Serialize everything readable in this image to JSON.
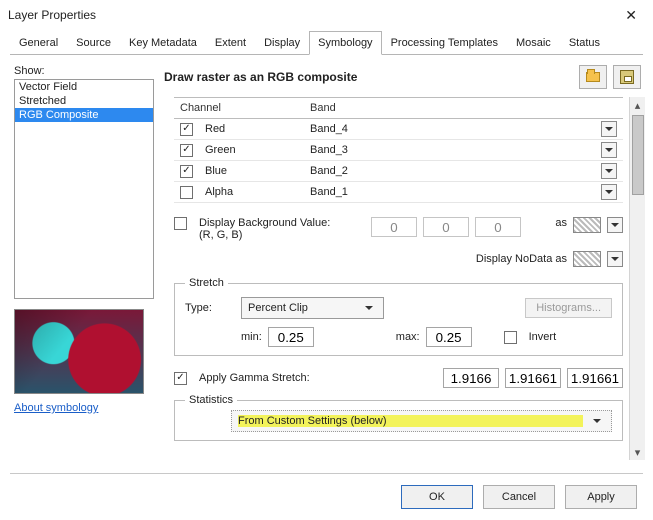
{
  "window": {
    "title": "Layer Properties"
  },
  "tabs": [
    "General",
    "Source",
    "Key Metadata",
    "Extent",
    "Display",
    "Symbology",
    "Processing Templates",
    "Mosaic",
    "Status"
  ],
  "active_tab": "Symbology",
  "left": {
    "show_label": "Show:",
    "items": [
      "Vector Field",
      "Stretched",
      "RGB Composite"
    ],
    "selected": "RGB Composite",
    "about_link": "About symbology"
  },
  "header": {
    "title": "Draw raster as an RGB composite"
  },
  "channels": {
    "col_channel": "Channel",
    "col_band": "Band",
    "rows": [
      {
        "checked": true,
        "name": "Red",
        "band": "Band_4"
      },
      {
        "checked": true,
        "name": "Green",
        "band": "Band_3"
      },
      {
        "checked": true,
        "name": "Blue",
        "band": "Band_2"
      },
      {
        "checked": false,
        "name": "Alpha",
        "band": "Band_1"
      }
    ]
  },
  "bg": {
    "checked": false,
    "label": "Display Background Value:(R, G, B)",
    "r": "0",
    "g": "0",
    "b": "0",
    "as_label": "as"
  },
  "nodata": {
    "label": "Display NoData as"
  },
  "stretch": {
    "legend": "Stretch",
    "type_label": "Type:",
    "type_value": "Percent Clip",
    "histograms": "Histograms...",
    "min_label": "min:",
    "min": "0.25",
    "max_label": "max:",
    "max": "0.25",
    "invert_label": "Invert",
    "invert_checked": false
  },
  "gamma": {
    "checked": true,
    "label": "Apply Gamma Stretch:",
    "v1": "1.9166",
    "v2": "1.91661",
    "v3": "1.91661"
  },
  "stats": {
    "legend": "Statistics",
    "source": "From Custom Settings (below)"
  },
  "footer": {
    "ok": "OK",
    "cancel": "Cancel",
    "apply": "Apply"
  }
}
